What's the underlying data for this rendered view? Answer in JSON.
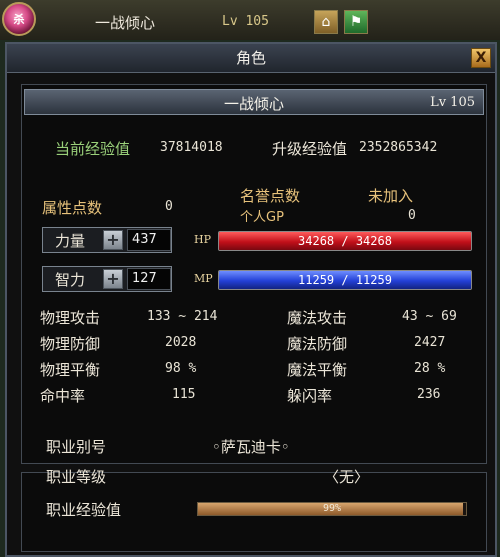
{
  "topbar": {
    "orb_glyph": "杀",
    "name": "一战倾心",
    "level": "Lv 105"
  },
  "window": {
    "title": "角色",
    "close": "X"
  },
  "character": {
    "name": "一战倾心",
    "level": "Lv 105",
    "current_exp_label": "当前经验值",
    "current_exp_value": "37814018",
    "next_exp_label": "升级经验值",
    "next_exp_value": "2352865342",
    "attr_points_label": "属性点数",
    "attr_points_value": "0",
    "honor_label": "名誉点数",
    "personal_gp_label": "个人GP",
    "not_joined_label": "未加入",
    "personal_gp_value": "0"
  },
  "stats": {
    "strength": {
      "label": "力量",
      "value": "437",
      "bar_label": "HP",
      "bar_text": "34268 / 34268",
      "fill": 1.0
    },
    "intellect": {
      "label": "智力",
      "value": "127",
      "bar_label": "MP",
      "bar_text": "11259 / 11259",
      "fill": 1.0
    },
    "plus": "+"
  },
  "combat": {
    "phys_atk_label": "物理攻击",
    "phys_atk_value": "133 ~ 214",
    "mag_atk_label": "魔法攻击",
    "mag_atk_value": "43 ~ 69",
    "phys_def_label": "物理防御",
    "phys_def_value": "2028",
    "mag_def_label": "魔法防御",
    "mag_def_value": "2427",
    "phys_bal_label": "物理平衡",
    "phys_bal_value": "98 %",
    "mag_bal_label": "魔法平衡",
    "mag_bal_value": "28 %",
    "hit_label": "命中率",
    "hit_value": "115",
    "dodge_label": "躲闪率",
    "dodge_value": "236"
  },
  "job": {
    "alias_label": "职业别号",
    "alias_value": "◦萨瓦迪卡◦",
    "level_label": "职业等级",
    "level_value": "〈无〉",
    "exp_label": "职业经验值",
    "exp_text": "99%",
    "exp_fill": 0.99
  }
}
